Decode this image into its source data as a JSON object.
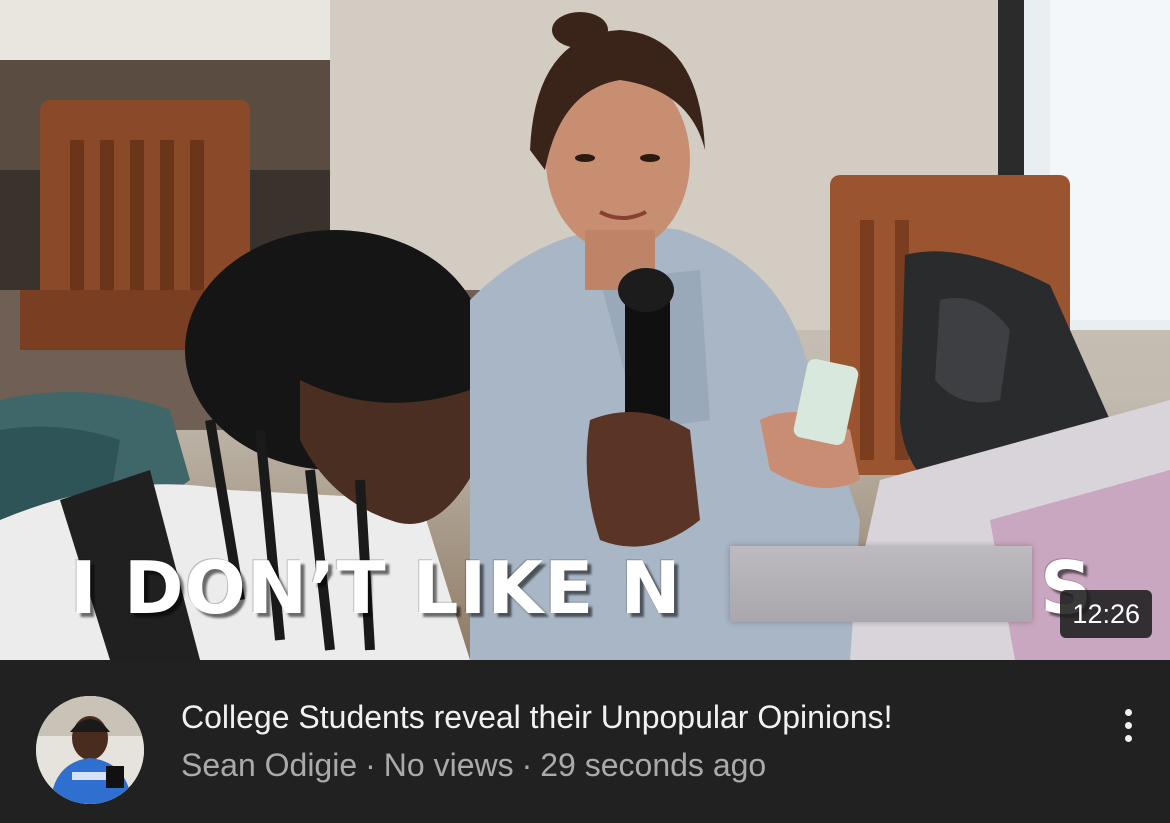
{
  "video": {
    "thumbnail_caption_visible": "I DON’T LIKE N",
    "thumbnail_caption_tail": "S",
    "duration": "12:26",
    "title": "College Students reveal their Unpopular Opinions!",
    "channel": "Sean Odigie",
    "views": "No views",
    "age": "29 seconds ago",
    "separator": "·"
  },
  "icons": {
    "more": "more-vert-icon",
    "avatar": "channel-avatar"
  },
  "colors": {
    "background": "#212121",
    "title": "#f1f1f1",
    "meta": "#aaaaaa"
  }
}
